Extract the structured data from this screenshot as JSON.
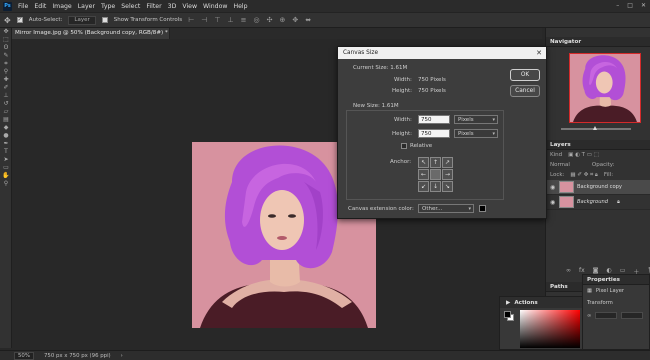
{
  "menubar": {
    "logo": "Ps",
    "items": [
      "File",
      "Edit",
      "Image",
      "Layer",
      "Type",
      "Select",
      "Filter",
      "3D",
      "View",
      "Window",
      "Help"
    ],
    "window_controls": [
      "–",
      "□",
      "✕"
    ]
  },
  "options": {
    "auto_select_label": "Auto-Select:",
    "auto_select_value": "Layer",
    "show_transform_label": "Show Transform Controls"
  },
  "document": {
    "tab_title": "Mirror Image.jpg @ 50% (Background copy, RGB/8#) *",
    "tab_close": "×"
  },
  "status": {
    "zoom": "50%",
    "doc_info": "750 px x 750 px (96 ppi)",
    "arrow": "›"
  },
  "navigator": {
    "title": "Navigator"
  },
  "layers": {
    "title": "Layers",
    "kind_label": "Kind",
    "mode": "Normal",
    "opacity_label": "Opacity:",
    "lock_label": "Lock:",
    "fill_label": "Fill:",
    "rows": [
      {
        "name": "Background copy",
        "selected": true
      },
      {
        "name": "Background",
        "selected": false
      }
    ]
  },
  "paths": {
    "title": "Paths"
  },
  "properties": {
    "title": "Properties",
    "pixel_layer_label": "Pixel Layer",
    "transform_label": "Transform"
  },
  "actions": {
    "title": "Actions"
  },
  "dialog": {
    "title": "Canvas Size",
    "close": "✕",
    "current_size_label": "Current Size: 1.61M",
    "current_width_label": "Width:",
    "current_width_value": "750 Pixels",
    "current_height_label": "Height:",
    "current_height_value": "750 Pixels",
    "new_size_label": "New Size: 1.61M",
    "width_label": "Width:",
    "width_value": "750",
    "width_unit": "Pixels",
    "height_label": "Height:",
    "height_value": "750",
    "height_unit": "Pixels",
    "relative_label": "Relative",
    "anchor_label": "Anchor:",
    "anchor_arrows": [
      "↖",
      "↑",
      "↗",
      "←",
      "",
      "→",
      "↙",
      "↓",
      "↘"
    ],
    "ext_color_label": "Canvas extension color:",
    "ext_color_value": "Other...",
    "ext_color_swatch": "#000000",
    "ok_label": "OK",
    "cancel_label": "Cancel"
  },
  "colors": {
    "app_bg": "#282828",
    "panel_bg": "#323232",
    "photo_bg": "#d7929f",
    "accent_red": "#d42a2a"
  }
}
